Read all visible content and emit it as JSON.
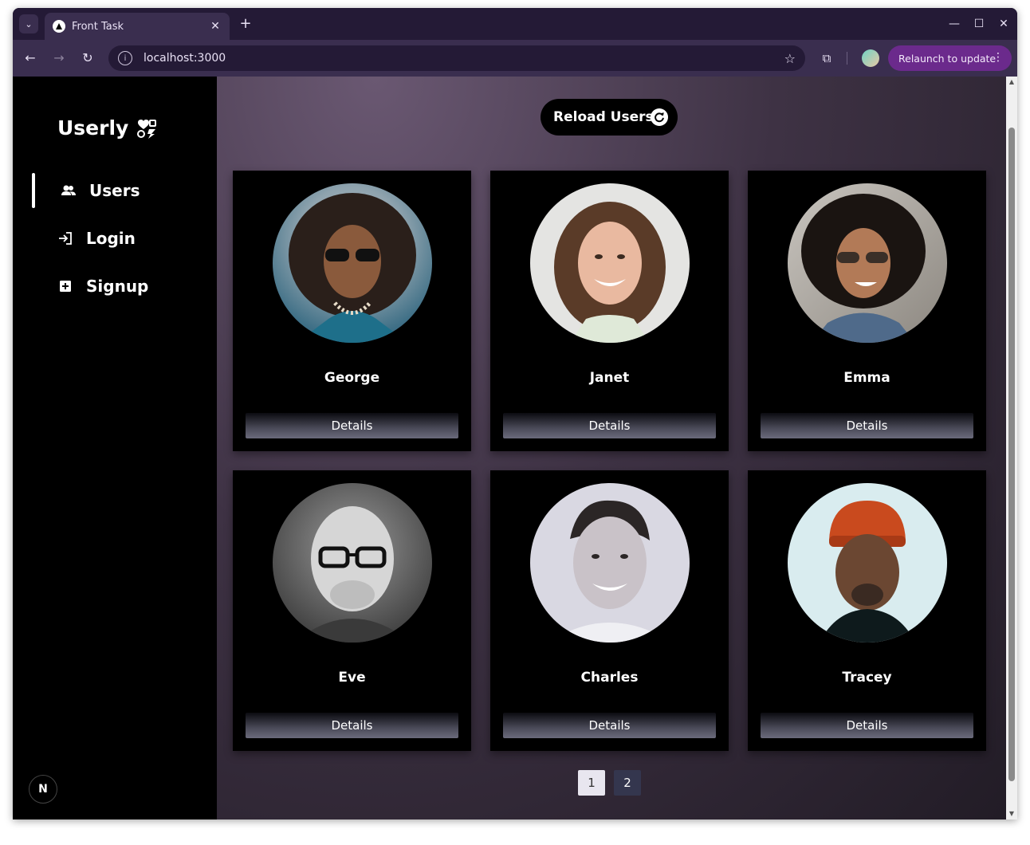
{
  "browser": {
    "tab_title": "Front Task",
    "url": "localhost:3000",
    "relaunch_label": "Relaunch to update",
    "colors": {
      "frame": "#241a36",
      "toolbar": "#3a2e4f",
      "relaunch": "#6b2a8c"
    }
  },
  "sidebar": {
    "logo_text": "Userly",
    "items": [
      {
        "label": "Users",
        "icon": "users-icon",
        "active": true
      },
      {
        "label": "Login",
        "icon": "login-icon",
        "active": false
      },
      {
        "label": "Signup",
        "icon": "plus-square-icon",
        "active": false
      }
    ],
    "badge": "N"
  },
  "main": {
    "reload_label": "Reload Users",
    "cards": [
      {
        "name": "George",
        "details_label": "Details",
        "avatar": "avatar-george"
      },
      {
        "name": "Janet",
        "details_label": "Details",
        "avatar": "avatar-janet"
      },
      {
        "name": "Emma",
        "details_label": "Details",
        "avatar": "avatar-emma"
      },
      {
        "name": "Eve",
        "details_label": "Details",
        "avatar": "avatar-eve"
      },
      {
        "name": "Charles",
        "details_label": "Details",
        "avatar": "avatar-charles"
      },
      {
        "name": "Tracey",
        "details_label": "Details",
        "avatar": "avatar-tracey"
      }
    ],
    "pagination": {
      "pages": [
        "1",
        "2"
      ],
      "current": "1"
    }
  }
}
